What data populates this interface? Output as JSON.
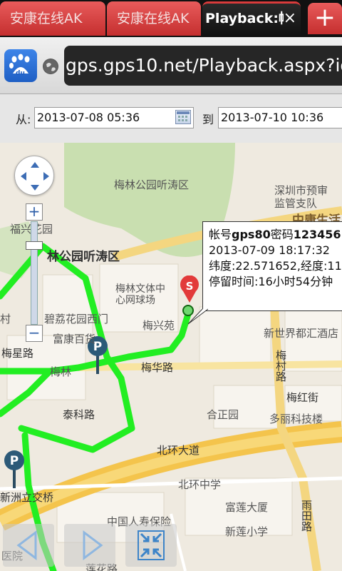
{
  "tabs": [
    {
      "label": "安康在线AK"
    },
    {
      "label": "安康在线AK"
    },
    {
      "label": "Playback:帐",
      "close": "×"
    }
  ],
  "newtab": "+",
  "url": "gps.gps10.net/Playback.aspx?id",
  "date_range": {
    "from_label": "从:",
    "from_value": "2013-07-08 05:36",
    "to_label": "到",
    "to_value": "2013-07-10 10:36"
  },
  "popup": {
    "l1a": "帐号",
    "l1b": "gps80",
    "l1c": "密码",
    "l1d": "123456",
    "line2": "2013-07-09 18:17:32",
    "line3": "纬度:22.571652,经度:11",
    "line4": "停留时间:16小时54分钟"
  },
  "map_labels": [
    "梅林公园听涛区",
    "深圳市预审",
    "监管支队",
    "福兴花园",
    "林公园听涛区",
    "梅林文体中",
    "心网球场",
    "村",
    "碧荔花园西门",
    "梅兴苑",
    "富康百货",
    "梅星路",
    "梅林",
    "梅华路",
    "新世界都汇酒店",
    "梅村路",
    "梅红街",
    "泰科路",
    "合正园",
    "多丽科技楼",
    "北环大道",
    "北环中学",
    "新洲立交桥",
    "富莲大厦",
    "中国人寿保险",
    "新莲小学",
    "雨田路",
    "医院",
    "莲花路",
    "中康生活"
  ],
  "marker": {
    "start": "S",
    "parking": "P"
  },
  "zoom": {
    "in": "+",
    "out": "−"
  }
}
